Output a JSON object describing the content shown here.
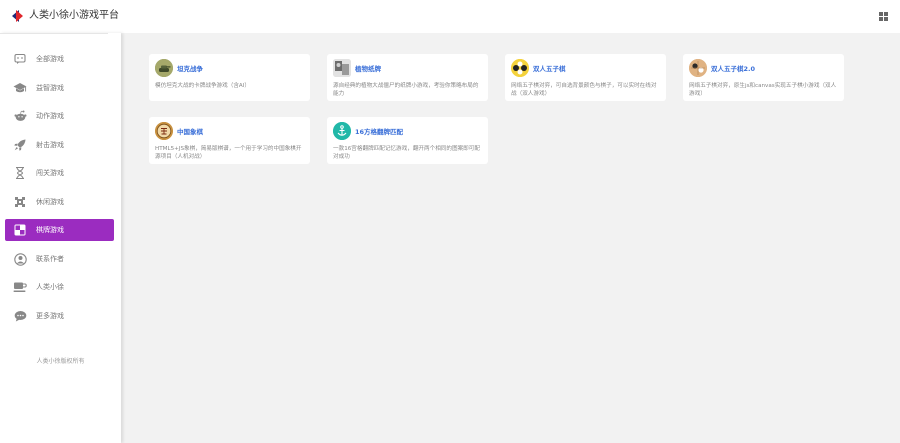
{
  "header": {
    "brand": "人类小徐小游戏平台",
    "logo_icon": "brand-logo-icon",
    "windows_icon": "windows-icon"
  },
  "sidebar": {
    "items": [
      {
        "label": "全部游戏",
        "icon": "chat-bubble-icon",
        "active": false
      },
      {
        "label": "益智游戏",
        "icon": "graduation-cap-icon",
        "active": false
      },
      {
        "label": "动作游戏",
        "icon": "reddit-alien-icon",
        "active": false
      },
      {
        "label": "射击游戏",
        "icon": "rocket-icon",
        "active": false
      },
      {
        "label": "闯关游戏",
        "icon": "hourglass-icon",
        "active": false
      },
      {
        "label": "休闲游戏",
        "icon": "sprite-icon",
        "active": false
      },
      {
        "label": "棋牌游戏",
        "icon": "chessboard-icon",
        "active": true
      },
      {
        "label": "联系作者",
        "icon": "user-circle-icon",
        "active": false
      },
      {
        "label": "人类小徐",
        "icon": "coffee-cup-icon",
        "active": false
      },
      {
        "label": "更多游戏",
        "icon": "speech-dots-icon",
        "active": false
      }
    ],
    "footer": "人类小徐版权所有",
    "active_color": "#9b2cc0"
  },
  "games": [
    {
      "title": "坦克战争",
      "desc": "模仿坦克大战的卡牌战争游戏（含AI）",
      "avatar": "tank-avatar-icon"
    },
    {
      "title": "植物纸牌",
      "desc": "源自经典的植物大战僵尸的纸牌小游戏，考验你策略布局的能力",
      "avatar": "plant-card-avatar-icon"
    },
    {
      "title": "双人五子棋",
      "desc": "网络五子棋对弈，可自选背景颜色与棋子，可以实时在线对战（双人游戏）",
      "avatar": "gomoku-avatar-icon"
    },
    {
      "title": "双人五子棋2.0",
      "desc": "网络五子棋对弈，原生js和canvas实现五子棋小游戏（双人游戏）",
      "avatar": "gomoku2-avatar-icon"
    },
    {
      "title": "中国象棋",
      "desc": "HTML5+JS象棋，简易版棋谱，一个用于学习的中国象棋开源项目（人机对战）",
      "avatar": "chinese-chess-avatar-icon"
    },
    {
      "title": "16方格翻牌匹配",
      "desc": "一款16宫格翻牌匹配记忆游戏，翻开两个相同的图案即可配对成功",
      "avatar": "anchor-avatar-icon"
    }
  ]
}
